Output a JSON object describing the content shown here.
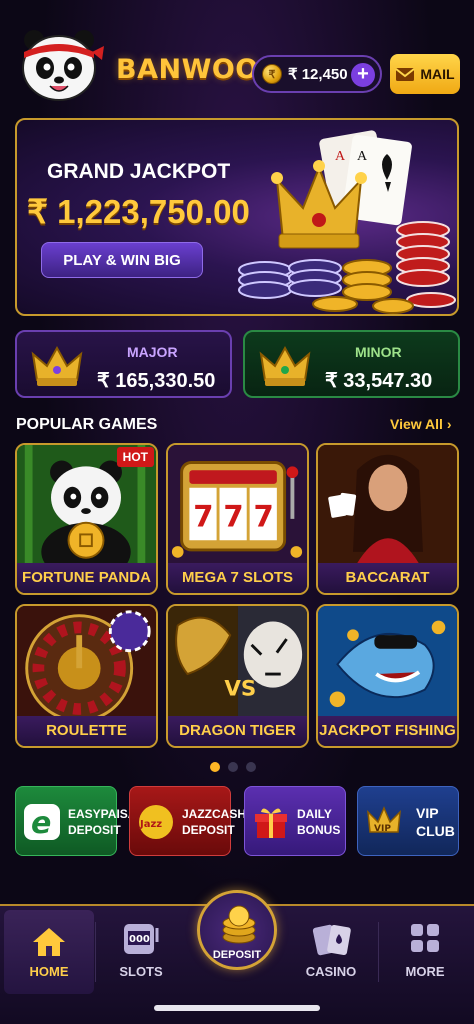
{
  "header": {
    "brand": "BANWOO",
    "balance": "₹ 12,450",
    "mail_label": "MAIL"
  },
  "jackpot": {
    "title": "GRAND JACKPOT",
    "amount": "₹ 1,223,750.00",
    "button": "PLAY & WIN BIG"
  },
  "tiers": [
    {
      "label": "MAJOR",
      "value": "₹ 165,330.50"
    },
    {
      "label": "MINOR",
      "value": "₹ 33,547.30"
    }
  ],
  "popular": {
    "title": "POPULAR GAMES",
    "view_all": "View All",
    "games": [
      {
        "name": "FORTUNE PANDA",
        "badge": "HOT"
      },
      {
        "name": "MEGA 7 SLOTS"
      },
      {
        "name": "BACCARAT"
      },
      {
        "name": "ROULETTE"
      },
      {
        "name": "DRAGON TIGER"
      },
      {
        "name": "JACKPOT FISHING"
      }
    ],
    "page_dots": 3,
    "active_dot": 1
  },
  "quick_actions": [
    {
      "line1": "EASYPAISA",
      "line2": "DEPOSIT"
    },
    {
      "line1": "JAZZCASH",
      "line2": "DEPOSIT"
    },
    {
      "line1": "DAILY",
      "line2": "BONUS"
    },
    {
      "line1": "VIP",
      "line2": "CLUB"
    }
  ],
  "nav": {
    "home": "HOME",
    "slots": "SLOTS",
    "deposit": "DEPOSIT",
    "casino": "CASINO",
    "more": "MORE"
  },
  "icons": {
    "coin": "coin-icon",
    "plus": "plus-icon",
    "mail": "envelope-icon",
    "home": "house-icon",
    "slots": "slot-machine-icon",
    "casino": "playing-cards-icon",
    "more": "grid-icon"
  },
  "colors": {
    "accent_gold": "#ffc93c",
    "accent_purple": "#7b3fe0",
    "background": "#0c0716"
  }
}
